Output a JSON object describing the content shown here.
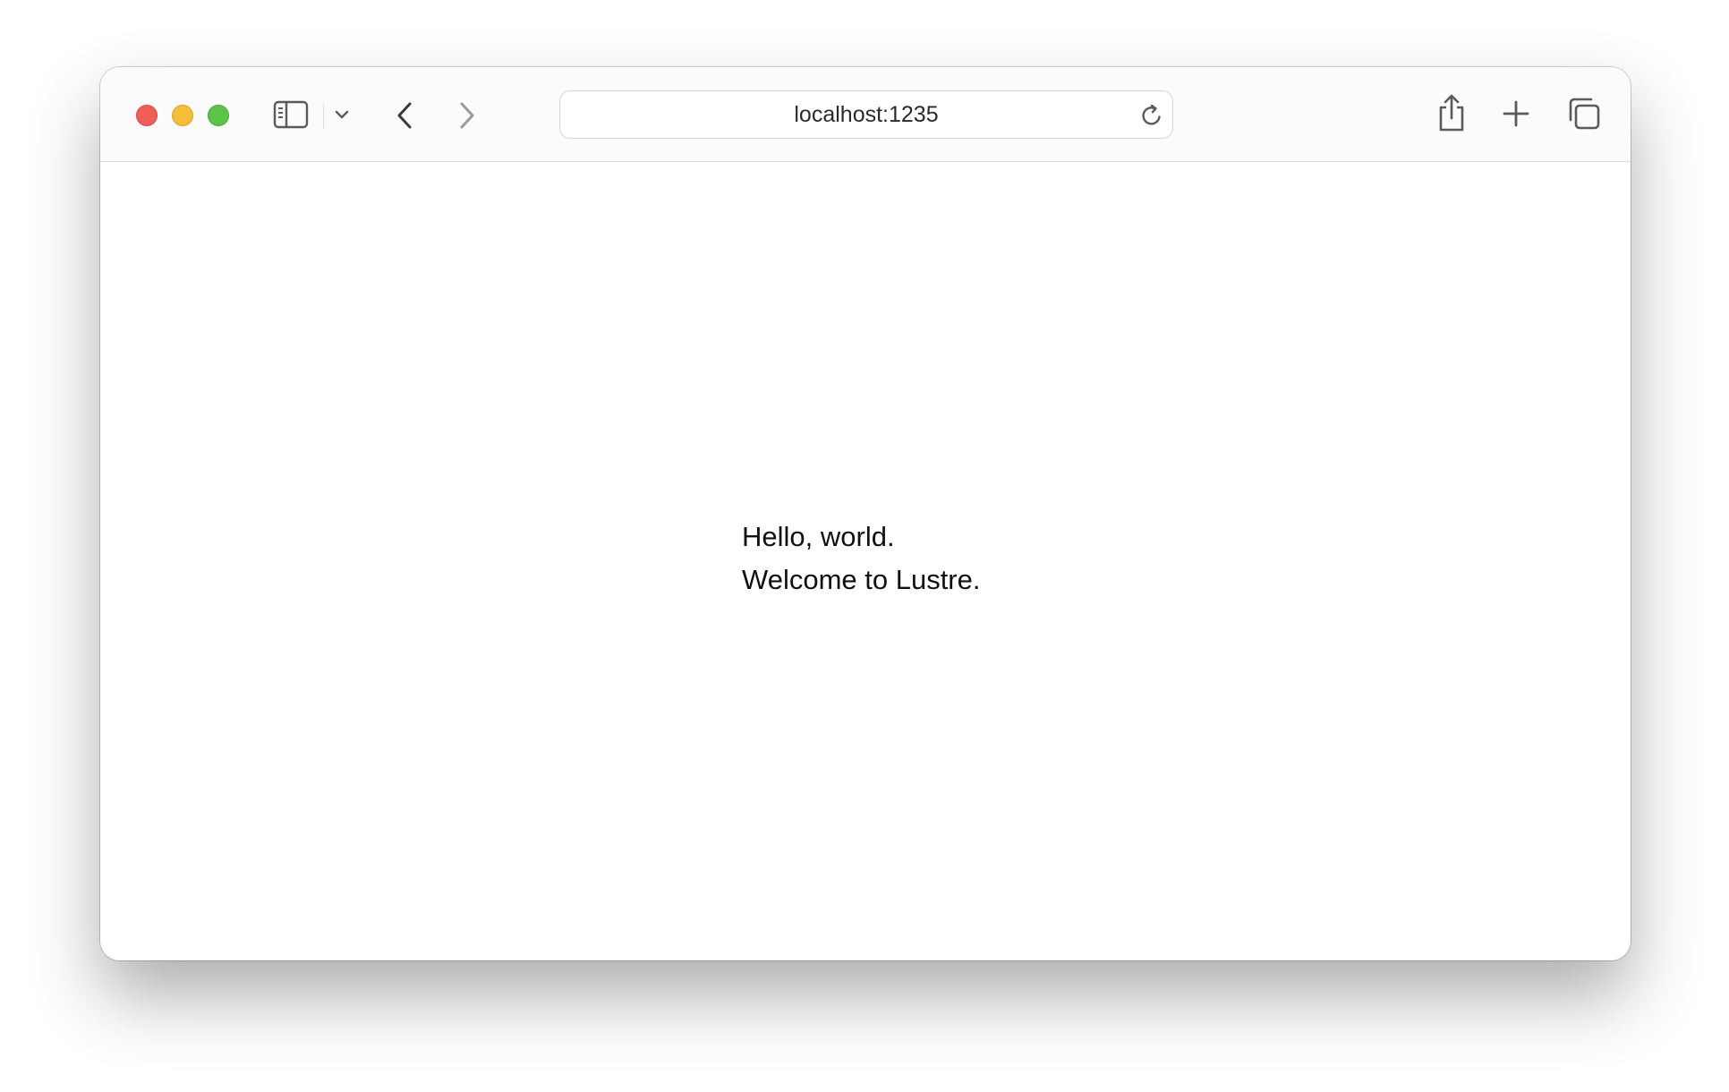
{
  "browser": {
    "address_bar": {
      "url": "localhost:1235"
    },
    "window_controls": [
      "close",
      "minimize",
      "zoom"
    ],
    "toolbar_icons": {
      "sidebar": "sidebar-icon",
      "tab_group_menu": "chevron-down-icon",
      "back": "chevron-left-icon",
      "forward": "chevron-right-icon",
      "reload": "reload-icon",
      "share": "share-icon",
      "new_tab": "plus-icon",
      "tab_overview": "tabs-overview-icon"
    },
    "colors": {
      "close": "#ee5f57",
      "minimize": "#f6bd3a",
      "zoom": "#5ec447"
    }
  },
  "page": {
    "line1": "Hello, world.",
    "line2": "Welcome to Lustre."
  }
}
